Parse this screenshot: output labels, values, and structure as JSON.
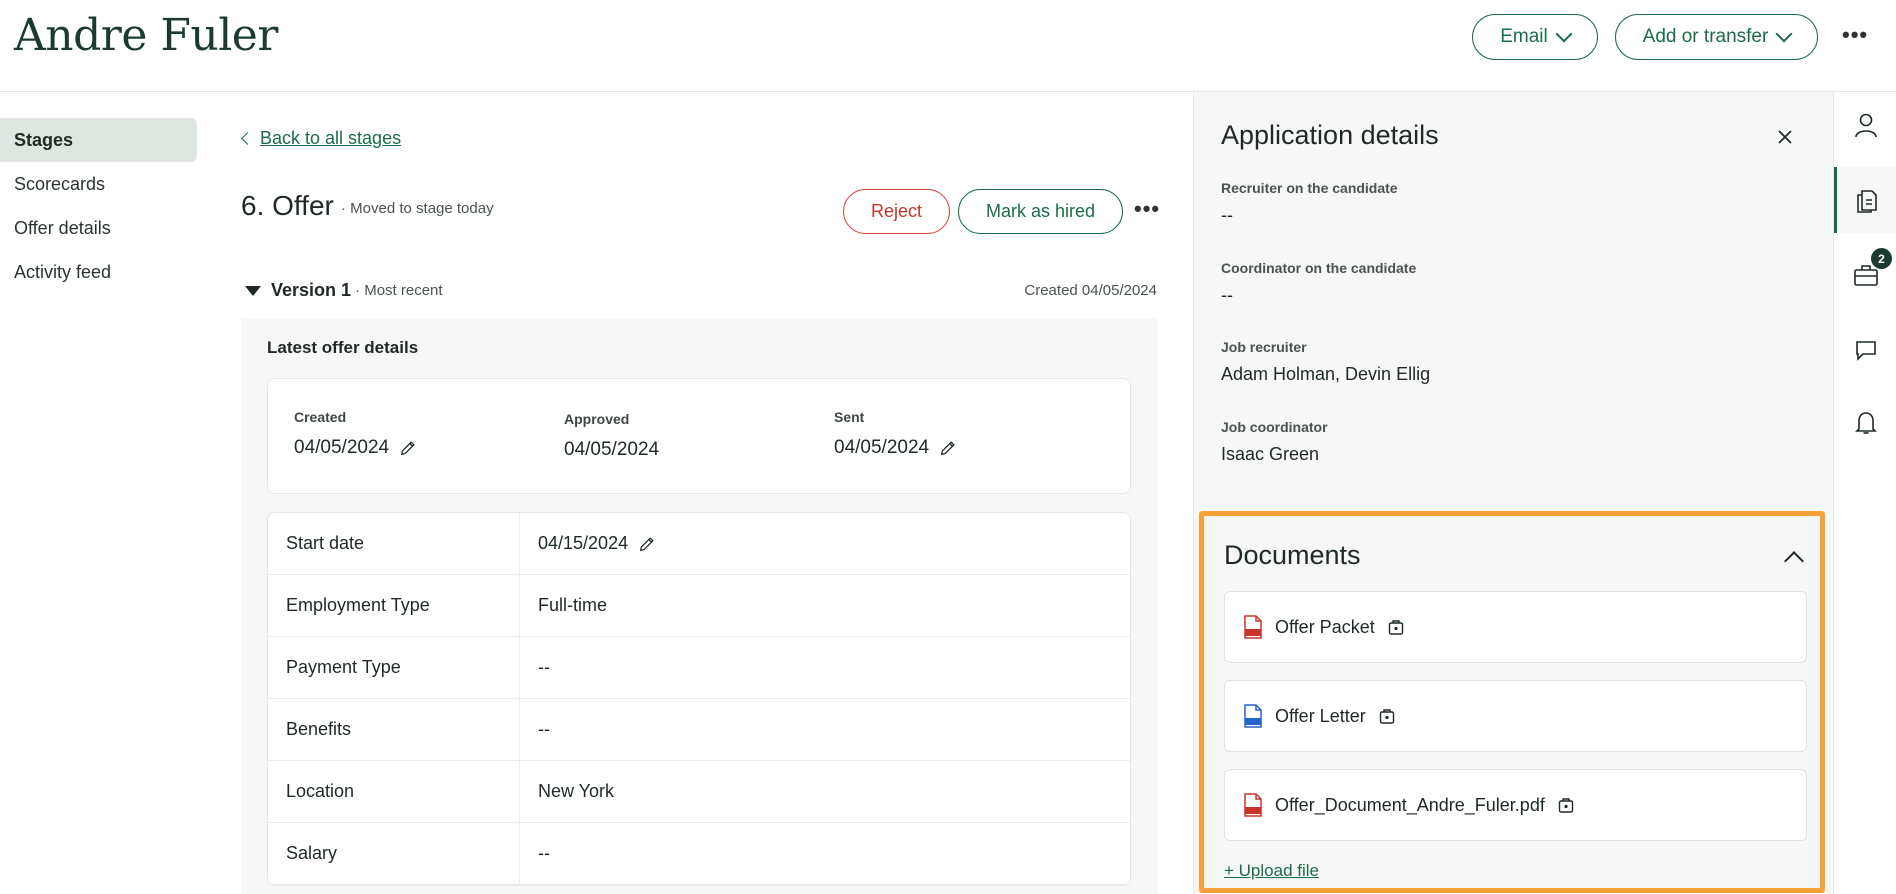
{
  "header": {
    "candidate_name": "Andre Fuler",
    "email_label": "Email",
    "add_transfer_label": "Add or transfer",
    "more_label": "•••"
  },
  "nav": {
    "items": [
      {
        "label": "Stages",
        "active": true
      },
      {
        "label": "Scorecards"
      },
      {
        "label": "Offer details"
      },
      {
        "label": "Activity feed"
      }
    ]
  },
  "main": {
    "back_link": "Back to all stages",
    "stage_title": "6. Offer",
    "stage_sub": "· Moved to stage today",
    "reject_label": "Reject",
    "hired_label": "Mark as hired",
    "more_label": "•••",
    "version_label": "Version 1",
    "version_sub": "· Most recent",
    "version_created": "Created 04/05/2024",
    "offer_panel_title": "Latest offer details",
    "dates": {
      "created_label": "Created",
      "created_value": "04/05/2024",
      "approved_label": "Approved",
      "approved_value": "04/05/2024",
      "sent_label": "Sent",
      "sent_value": "04/05/2024"
    },
    "details": [
      {
        "key": "Start date",
        "value": "04/15/2024"
      },
      {
        "key": "Employment Type",
        "value": "Full-time"
      },
      {
        "key": "Payment Type",
        "value": "--"
      },
      {
        "key": "Benefits",
        "value": "--"
      },
      {
        "key": "Location",
        "value": "New York"
      },
      {
        "key": "Salary",
        "value": "--"
      }
    ]
  },
  "drawer": {
    "title": "Application details",
    "fields": {
      "recruiter_label": "Recruiter on the candidate",
      "recruiter_value": "--",
      "coordinator_label": "Coordinator on the candidate",
      "coordinator_value": "--",
      "job_recruiter_label": "Job recruiter",
      "job_recruiter_value": "Adam Holman, Devin Ellig",
      "job_coordinator_label": "Job coordinator",
      "job_coordinator_value": "Isaac Green"
    },
    "documents": {
      "title": "Documents",
      "items": [
        {
          "name": "Offer Packet",
          "type": "PDF"
        },
        {
          "name": "Offer Letter",
          "type": "DOCX"
        },
        {
          "name": "Offer_Document_Andre_Fuler.pdf",
          "type": "PDF"
        }
      ],
      "upload_label": "+ Upload file"
    },
    "highlight_color": "#f5a23a"
  },
  "rail": {
    "icons": [
      "person-icon",
      "documents-icon",
      "briefcase-icon",
      "chat-icon",
      "bell-icon"
    ],
    "briefcase_badge": "2"
  },
  "colors": {
    "brand_green": "#1c6b4a",
    "reject_red": "#d9453b"
  }
}
